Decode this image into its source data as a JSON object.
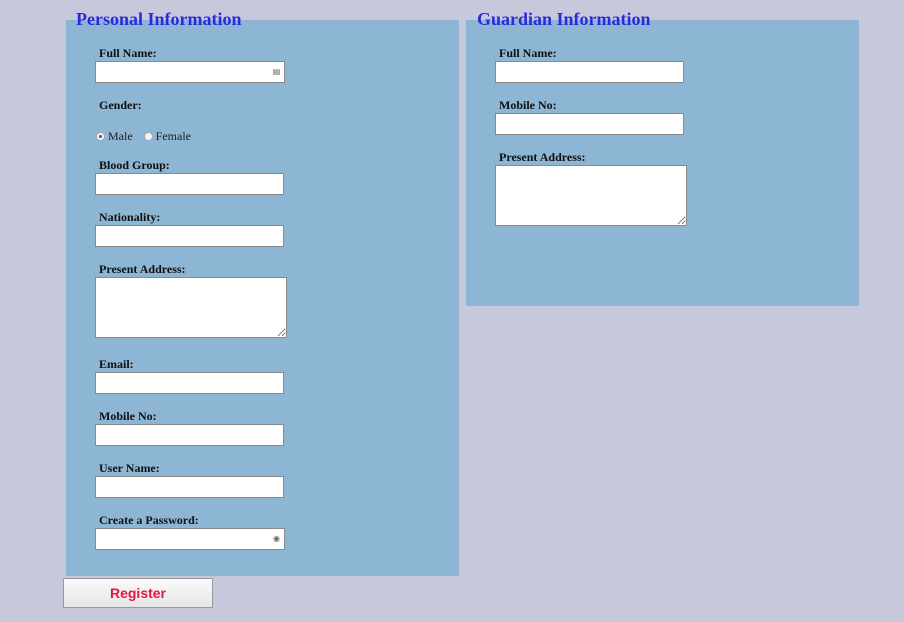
{
  "personal": {
    "title": "Personal Information",
    "full_name_label": "Full Name:",
    "gender_label": "Gender:",
    "gender_options": [
      "Male",
      "Female"
    ],
    "gender_selected": "Male",
    "blood_group_label": "Blood Group:",
    "nationality_label": "Nationality:",
    "present_address_label": "Present Address:",
    "email_label": "Email:",
    "mobile_label": "Mobile No:",
    "username_label": "User Name:",
    "password_label": "Create a Password:"
  },
  "guardian": {
    "title": "Guardian Information",
    "full_name_label": "Full Name:",
    "mobile_label": "Mobile No:",
    "present_address_label": "Present Address:"
  },
  "actions": {
    "register_label": "Register"
  },
  "colors": {
    "page_background": "#c8c8dc",
    "panel_background": "#8cb6d4",
    "title_color": "#2a2ad8",
    "register_text": "#e0184a"
  },
  "icons": {
    "full_name_field": "contact-card-icon",
    "password_field": "key-icon"
  }
}
